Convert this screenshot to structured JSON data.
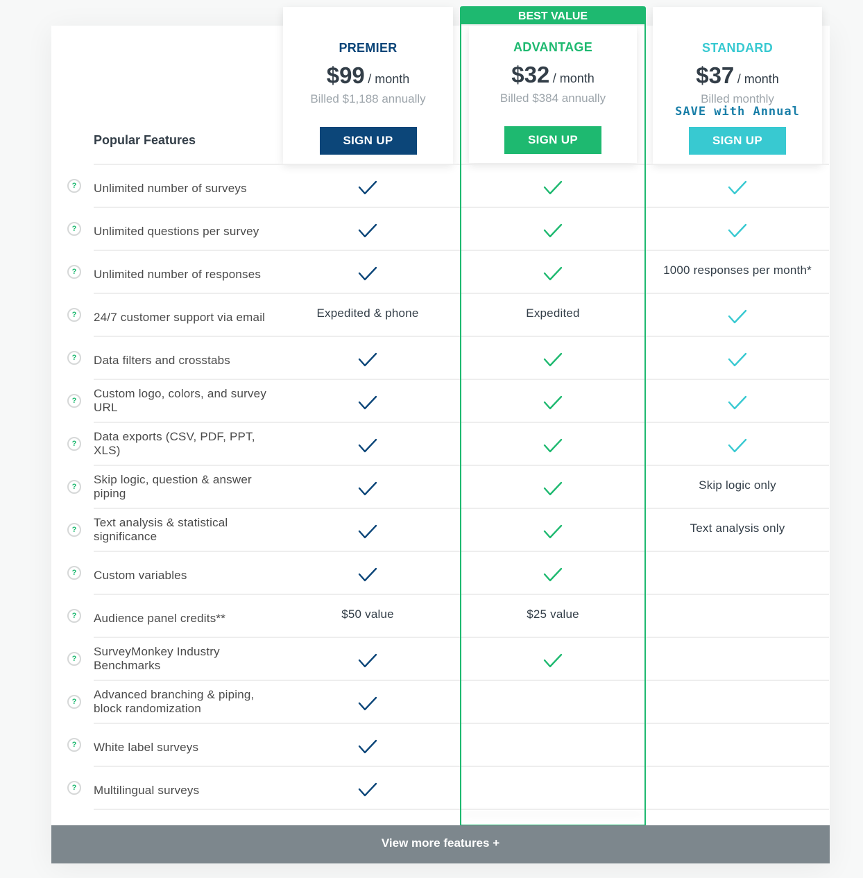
{
  "colors": {
    "premier": "#0c4679",
    "advantage": "#1eb970",
    "standard": "#38c9d1",
    "save_link": "#1a7fa8"
  },
  "section_title": "Popular Features",
  "best_value_label": "BEST VALUE",
  "plans": [
    {
      "id": "premier",
      "name": "PREMIER",
      "price": "$99",
      "period": "/ month",
      "billing": "Billed $1,188 annually",
      "save": "",
      "cta": "SIGN UP"
    },
    {
      "id": "advantage",
      "name": "ADVANTAGE",
      "price": "$32",
      "period": "/ month",
      "billing": "Billed $384 annually",
      "save": "",
      "cta": "SIGN UP"
    },
    {
      "id": "standard",
      "name": "STANDARD",
      "price": "$37",
      "period": "/ month",
      "billing": "Billed monthly",
      "save": "SAVE with Annual",
      "cta": "SIGN UP"
    }
  ],
  "features": [
    {
      "label": "Unlimited number of surveys",
      "help_icon": "question-circle-icon",
      "values": [
        "check",
        "check",
        "check"
      ]
    },
    {
      "label": "Unlimited questions per survey",
      "help_icon": "question-circle-icon",
      "values": [
        "check",
        "check",
        "check"
      ]
    },
    {
      "label": "Unlimited number of responses",
      "help_icon": "question-circle-icon",
      "values": [
        "check",
        "check",
        "1000 responses per month*"
      ]
    },
    {
      "label": "24/7 customer support via email",
      "help_icon": "question-circle-icon",
      "values": [
        "Expedited & phone",
        "Expedited",
        "check"
      ]
    },
    {
      "label": "Data filters and crosstabs",
      "help_icon": "question-circle-icon",
      "values": [
        "check",
        "check",
        "check"
      ]
    },
    {
      "label": "Custom logo, colors, and survey URL",
      "help_icon": "question-circle-icon",
      "values": [
        "check",
        "check",
        "check"
      ]
    },
    {
      "label": "Data exports (CSV, PDF, PPT, XLS)",
      "help_icon": "question-circle-icon",
      "values": [
        "check",
        "check",
        "check"
      ]
    },
    {
      "label": "Skip logic, question & answer piping",
      "help_icon": "question-circle-icon",
      "values": [
        "check",
        "check",
        "Skip logic only"
      ]
    },
    {
      "label": "Text analysis & statistical significance",
      "help_icon": "question-circle-icon",
      "values": [
        "check",
        "check",
        "Text analysis only"
      ]
    },
    {
      "label": "Custom variables",
      "help_icon": "question-circle-icon",
      "values": [
        "check",
        "check",
        ""
      ]
    },
    {
      "label": "Audience panel credits**",
      "help_icon": "question-circle-icon",
      "values": [
        "$50 value",
        "$25 value",
        ""
      ]
    },
    {
      "label": "SurveyMonkey Industry Benchmarks",
      "help_icon": "question-circle-icon",
      "values": [
        "check",
        "check",
        ""
      ]
    },
    {
      "label": "Advanced branching & piping, block randomization",
      "help_icon": "question-circle-icon",
      "values": [
        "check",
        "",
        ""
      ]
    },
    {
      "label": "White label surveys",
      "help_icon": "question-circle-icon",
      "values": [
        "check",
        "",
        ""
      ]
    },
    {
      "label": "Multilingual surveys",
      "help_icon": "question-circle-icon",
      "values": [
        "check",
        "",
        ""
      ]
    }
  ],
  "help_glyph": "?",
  "view_more_label": "View more features +"
}
